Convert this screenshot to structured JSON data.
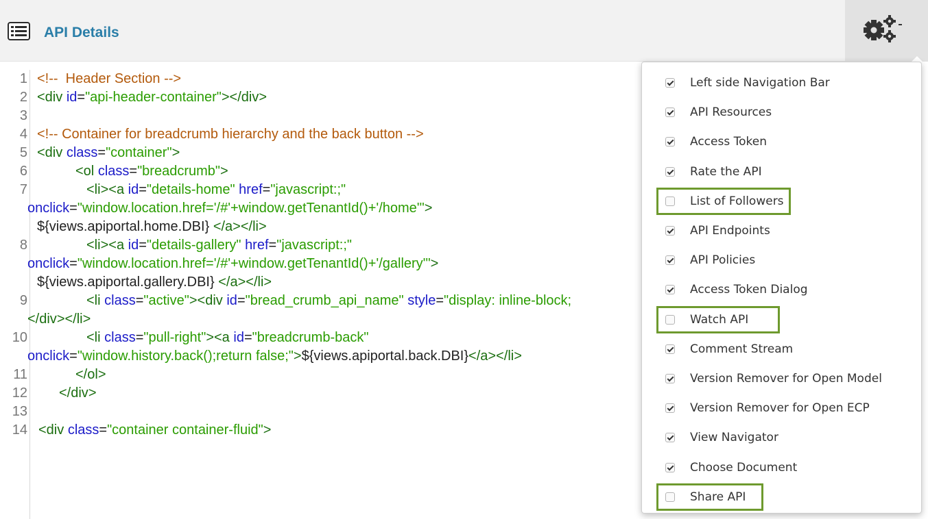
{
  "header": {
    "title": "API Details",
    "icon": "list-icon",
    "settings_icon": "gears-icon"
  },
  "editor": {
    "lines": [
      {
        "num": "1",
        "text": "<!--  Header Section -->"
      },
      {
        "num": "2",
        "text": "<div id=\"api-header-container\"></div>"
      },
      {
        "num": "3",
        "text": ""
      },
      {
        "num": "4",
        "text": "<!-- Container for breadcrumb hierarchy and the back button -->"
      },
      {
        "num": "5",
        "text": "<div class=\"container\">"
      },
      {
        "num": "6",
        "text": "<ol class=\"breadcrumb\">"
      },
      {
        "num": "7",
        "text": "<li><a id=\"details-home\" href=\"javascript:;\""
      },
      {
        "num": "",
        "text": "onclick=\"window.location.href='/#'+window.getTenantId()+'/home'\">"
      },
      {
        "num": "",
        "text": "${views.apiportal.home.DBI} </a></li>"
      },
      {
        "num": "8",
        "text": "<li><a id=\"details-gallery\" href=\"javascript:;\""
      },
      {
        "num": "",
        "text": "onclick=\"window.location.href='/#'+window.getTenantId()+'/gallery'\">"
      },
      {
        "num": "",
        "text": "${views.apiportal.gallery.DBI} </a></li>"
      },
      {
        "num": "9",
        "text": "<li class=\"active\"><div id=\"bread_crumb_api_name\" style=\"display: inline-block;"
      },
      {
        "num": "",
        "text": "</div></li>"
      },
      {
        "num": "10",
        "text": "<li class=\"pull-right\"><a id=\"breadcrumb-back\""
      },
      {
        "num": "",
        "text": "onclick=\"window.history.back();return false;\">${views.apiportal.back.DBI}</a></li>"
      },
      {
        "num": "11",
        "text": "</ol>"
      },
      {
        "num": "12",
        "text": "</div>"
      },
      {
        "num": "13",
        "text": ""
      },
      {
        "num": "14",
        "text": "<div class=\"container container-fluid\">"
      }
    ]
  },
  "menu": {
    "items": [
      {
        "label": "Left side Navigation Bar",
        "checked": true
      },
      {
        "label": "API Resources",
        "checked": true
      },
      {
        "label": "Access Token",
        "checked": true
      },
      {
        "label": "Rate the API",
        "checked": true
      },
      {
        "label": "List of Followers",
        "checked": false
      },
      {
        "label": "API Endpoints",
        "checked": true
      },
      {
        "label": "API Policies",
        "checked": true
      },
      {
        "label": "Access Token Dialog",
        "checked": true
      },
      {
        "label": "Watch API",
        "checked": false
      },
      {
        "label": "Comment Stream",
        "checked": true
      },
      {
        "label": "Version Remover for Open Model",
        "checked": true
      },
      {
        "label": "Version Remover for Open ECP",
        "checked": true
      },
      {
        "label": "View Navigator",
        "checked": true
      },
      {
        "label": "Choose Document",
        "checked": true
      },
      {
        "label": "Share API",
        "checked": false
      }
    ]
  },
  "colors": {
    "title": "#2a7ea8",
    "highlight": "#6e9a2e",
    "tag": "#1a6e0f",
    "attr": "#1b1bc8",
    "string": "#2a9c00",
    "comment": "#b35a0c"
  }
}
